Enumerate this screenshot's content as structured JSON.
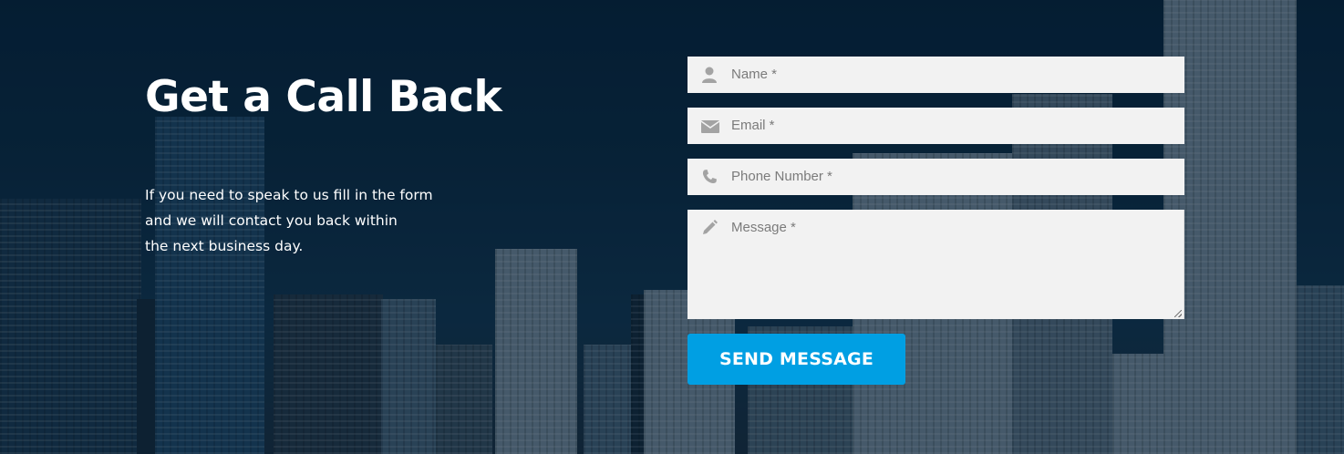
{
  "section": {
    "title": "Get a Call Back",
    "description_lines": [
      "If you need to speak to us fill in the form",
      "and we will contact you back within",
      "the next business day."
    ]
  },
  "form": {
    "name": {
      "placeholder": "Name *",
      "icon": "user-icon"
    },
    "email": {
      "placeholder": "Email *",
      "icon": "envelope-icon"
    },
    "phone": {
      "placeholder": "Phone Number *",
      "icon": "phone-icon"
    },
    "message": {
      "placeholder": "Message *",
      "icon": "pencil-icon"
    },
    "submit_label": "SEND MESSAGE"
  },
  "colors": {
    "accent": "#009fe3",
    "field_bg": "#f2f2f2",
    "placeholder": "#7b7b7b",
    "icon": "#9a9a9a"
  }
}
